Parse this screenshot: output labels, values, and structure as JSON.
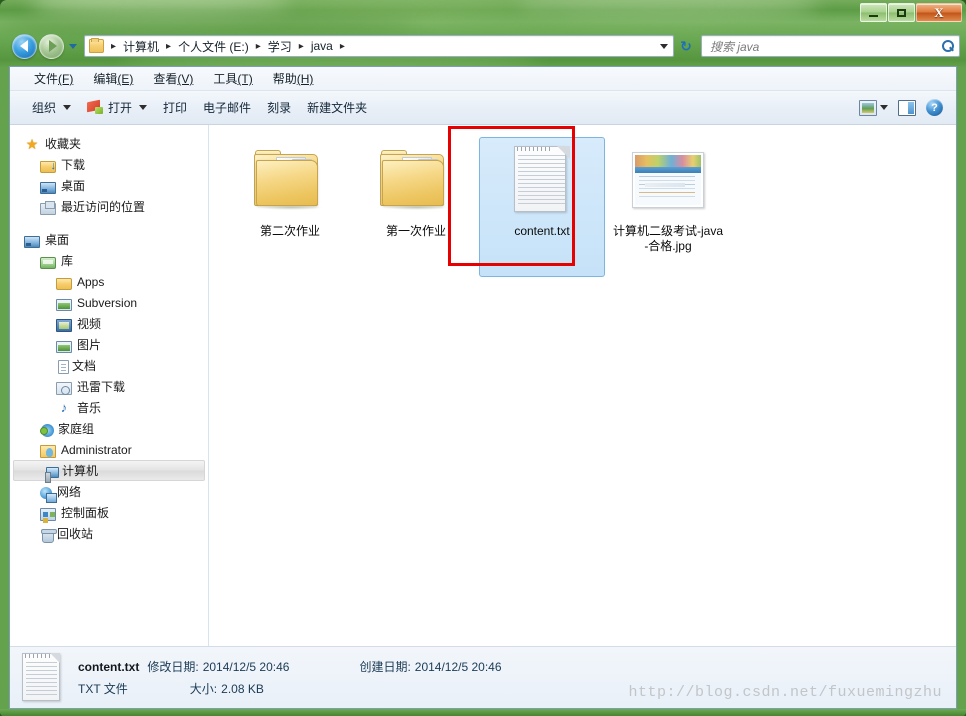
{
  "window": {
    "controls": {
      "minimize": "–",
      "maximize": "□",
      "close": "X"
    }
  },
  "nav": {
    "back_tooltip": "后退",
    "forward_tooltip": "前进",
    "history_tooltip": "最近的位置",
    "refresh_glyph": "↻",
    "breadcrumb": [
      "计算机",
      "个人文件 (E:)",
      "学习",
      "java"
    ],
    "separator": "▸"
  },
  "search": {
    "placeholder": "搜索 java"
  },
  "menubar": {
    "items": [
      {
        "text": "文件",
        "accel": "(F)"
      },
      {
        "text": "编辑",
        "accel": "(E)"
      },
      {
        "text": "查看",
        "accel": "(V)"
      },
      {
        "text": "工具",
        "accel": "(T)"
      },
      {
        "text": "帮助",
        "accel": "(H)"
      }
    ]
  },
  "toolbar": {
    "organize": "组织",
    "open": "打开",
    "print": "打印",
    "email": "电子邮件",
    "burn": "刻录",
    "new_folder": "新建文件夹",
    "help_glyph": "?"
  },
  "sidebar": {
    "groups": [
      {
        "items": [
          {
            "label": "收藏夹",
            "icon": "star-icon",
            "level": 0,
            "selected": false
          },
          {
            "label": "下载",
            "icon": "download-folder-icon",
            "level": 1,
            "selected": false
          },
          {
            "label": "桌面",
            "icon": "desktop-icon",
            "level": 1,
            "selected": false
          },
          {
            "label": "最近访问的位置",
            "icon": "recent-places-icon",
            "level": 1,
            "selected": false
          }
        ]
      },
      {
        "items": [
          {
            "label": "桌面",
            "icon": "desktop-icon",
            "level": 0,
            "selected": false
          },
          {
            "label": "库",
            "icon": "library-icon",
            "level": 1,
            "selected": false
          },
          {
            "label": "Apps",
            "icon": "folder-icon",
            "level": 2,
            "selected": false
          },
          {
            "label": "Subversion",
            "icon": "subversion-icon",
            "level": 2,
            "selected": false
          },
          {
            "label": "视频",
            "icon": "video-icon",
            "level": 2,
            "selected": false
          },
          {
            "label": "图片",
            "icon": "pictures-icon",
            "level": 2,
            "selected": false
          },
          {
            "label": "文档",
            "icon": "documents-icon",
            "level": 2,
            "selected": false
          },
          {
            "label": "迅雷下载",
            "icon": "thunder-download-icon",
            "level": 2,
            "selected": false
          },
          {
            "label": "音乐",
            "icon": "music-icon",
            "level": 2,
            "selected": false
          },
          {
            "label": "家庭组",
            "icon": "homegroup-icon",
            "level": 1,
            "selected": false
          },
          {
            "label": "Administrator",
            "icon": "user-folder-icon",
            "level": 1,
            "selected": false
          },
          {
            "label": "计算机",
            "icon": "computer-icon",
            "level": 1,
            "selected": true
          },
          {
            "label": "网络",
            "icon": "network-icon",
            "level": 1,
            "selected": false
          },
          {
            "label": "控制面板",
            "icon": "control-panel-icon",
            "level": 1,
            "selected": false
          },
          {
            "label": "回收站",
            "icon": "recycle-bin-icon",
            "level": 1,
            "selected": false
          }
        ]
      }
    ]
  },
  "files": [
    {
      "name": "第二次作业",
      "type": "folder",
      "selected": false
    },
    {
      "name": "第一次作业",
      "type": "folder",
      "selected": false
    },
    {
      "name": "content.txt",
      "type": "text",
      "selected": true
    },
    {
      "name": "计算机二级考试-java-合格.jpg",
      "type": "image",
      "selected": false
    }
  ],
  "annotation": {
    "color": "#e60000",
    "target": "content.txt"
  },
  "statusbar": {
    "file_name": "content.txt",
    "modified_key": "修改日期:",
    "modified_value": "2014/12/5 20:46",
    "created_key": "创建日期:",
    "created_value": "2014/12/5 20:46",
    "file_type": "TXT 文件",
    "size_key": "大小:",
    "size_value": "2.08 KB"
  },
  "watermark": "http://blog.csdn.net/fuxuemingzhu",
  "colors": {
    "frame_green": "#68a850",
    "selection_blue": "#c6e2f8",
    "annotation_red": "#e60000",
    "accent_blue": "#2b6fad"
  }
}
